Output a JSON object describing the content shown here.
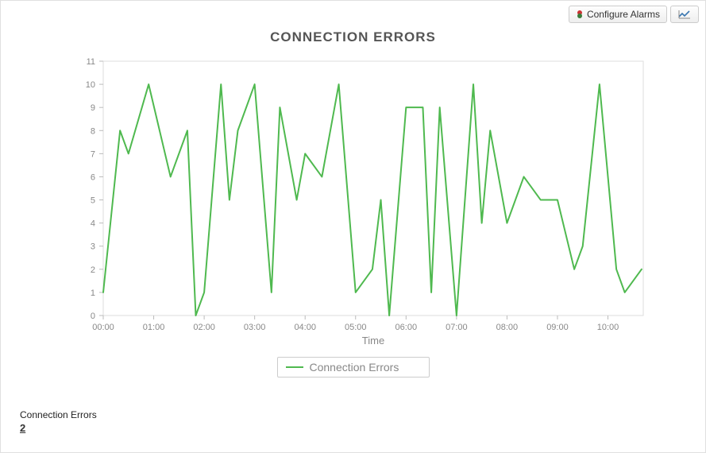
{
  "toolbar": {
    "configure_label": "Configure Alarms"
  },
  "chart_data": {
    "type": "line",
    "title": "CONNECTION ERRORS",
    "xlabel": "Time",
    "ylabel": "",
    "ylim": [
      0,
      11
    ],
    "yticks": [
      0,
      1,
      2,
      3,
      4,
      5,
      6,
      7,
      8,
      9,
      10,
      11
    ],
    "categories": [
      "00:00",
      "01:00",
      "02:00",
      "03:00",
      "04:00",
      "05:00",
      "06:00",
      "07:00",
      "08:00",
      "09:00",
      "10:00"
    ],
    "series": [
      {
        "name": "Connection Errors",
        "color": "#4fb94f",
        "x": [
          0,
          0.333,
          0.5,
          0.9,
          1.333,
          1.667,
          1.833,
          2.0,
          2.333,
          2.5,
          2.667,
          3.0,
          3.333,
          3.5,
          3.833,
          4.0,
          4.333,
          4.667,
          5.0,
          5.333,
          5.5,
          5.667,
          6.0,
          6.333,
          6.5,
          6.667,
          7.0,
          7.333,
          7.5,
          7.667,
          8.0,
          8.333,
          8.667,
          9.0,
          9.333,
          9.5,
          9.833,
          10.167,
          10.333,
          10.667
        ],
        "values": [
          1,
          8,
          7,
          10,
          6,
          8,
          0,
          1,
          10,
          5,
          8,
          10,
          1,
          9,
          5,
          7,
          6,
          10,
          1,
          2,
          5,
          0,
          9,
          9,
          1,
          9,
          0,
          10,
          4,
          8,
          4,
          6,
          5,
          5,
          2,
          3,
          10,
          2,
          1,
          2
        ]
      }
    ],
    "legend": {
      "label": "Connection Errors"
    }
  },
  "footer": {
    "label": "Connection Errors",
    "value": "2"
  }
}
